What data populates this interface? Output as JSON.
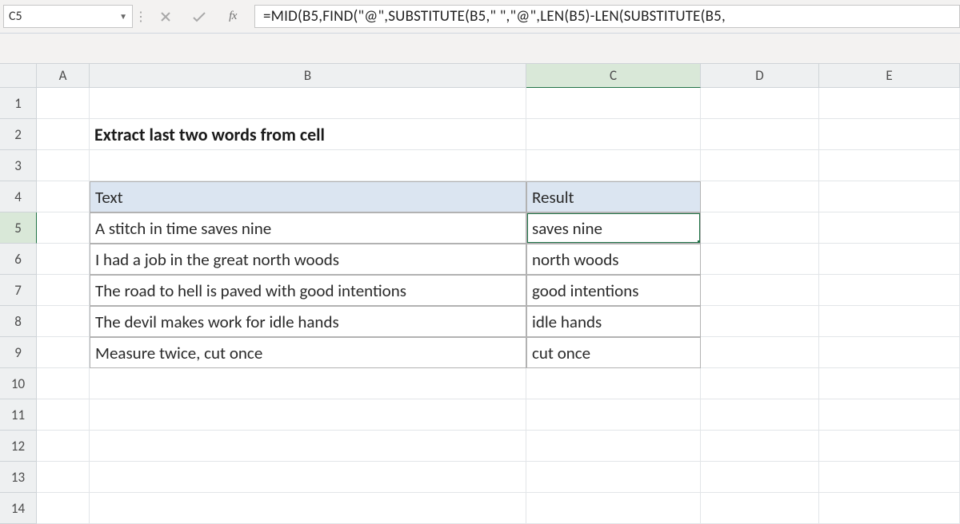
{
  "formulaBar": {
    "nameBox": "C5",
    "formula": "=MID(B5,FIND(\"@\",SUBSTITUTE(B5,\" \",\"@\",LEN(B5)-LEN(SUBSTITUTE(B5,"
  },
  "columns": [
    "A",
    "B",
    "C",
    "D",
    "E"
  ],
  "rowNumbers": [
    "1",
    "2",
    "3",
    "4",
    "5",
    "6",
    "7",
    "8",
    "9",
    "10",
    "11",
    "12",
    "13",
    "14"
  ],
  "activeCol": "C",
  "activeRow": "5",
  "sheet": {
    "title": "Extract last two words from cell",
    "headers": {
      "b": "Text",
      "c": "Result"
    },
    "rows": [
      {
        "b": "A stitch in time saves nine",
        "c": "saves nine"
      },
      {
        "b": "I had a job in the great north woods",
        "c": "north woods"
      },
      {
        "b": "The road to hell is paved with good intentions",
        "c": "good intentions"
      },
      {
        "b": "The devil makes work for idle hands",
        "c": "idle hands"
      },
      {
        "b": "Measure twice, cut once",
        "c": "cut once"
      }
    ]
  }
}
